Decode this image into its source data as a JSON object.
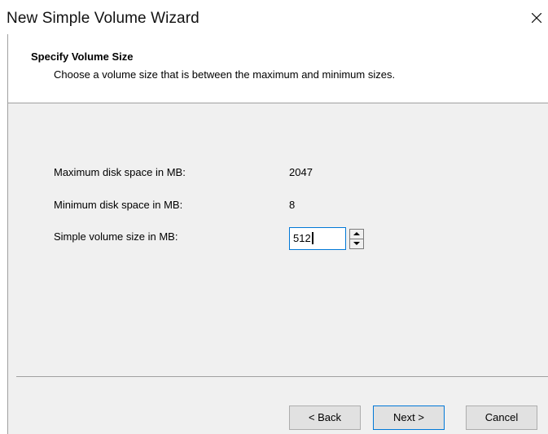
{
  "window": {
    "title": "New Simple Volume Wizard"
  },
  "header": {
    "title": "Specify Volume Size",
    "subtitle": "Choose a volume size that is between the maximum and minimum sizes."
  },
  "fields": {
    "max_label": "Maximum disk space in MB:",
    "max_value": "2047",
    "min_label": "Minimum disk space in MB:",
    "min_value": "8",
    "size_label": "Simple volume size in MB:",
    "size_value": "512"
  },
  "buttons": {
    "back": "< Back",
    "next": "Next >",
    "cancel": "Cancel"
  },
  "icons": {
    "close": "close-icon",
    "spin_up": "arrow-up-icon",
    "spin_down": "arrow-down-icon"
  },
  "colors": {
    "focus_border": "#0078d7",
    "panel_bg": "#f0f0f0",
    "header_bg": "#ffffff"
  }
}
